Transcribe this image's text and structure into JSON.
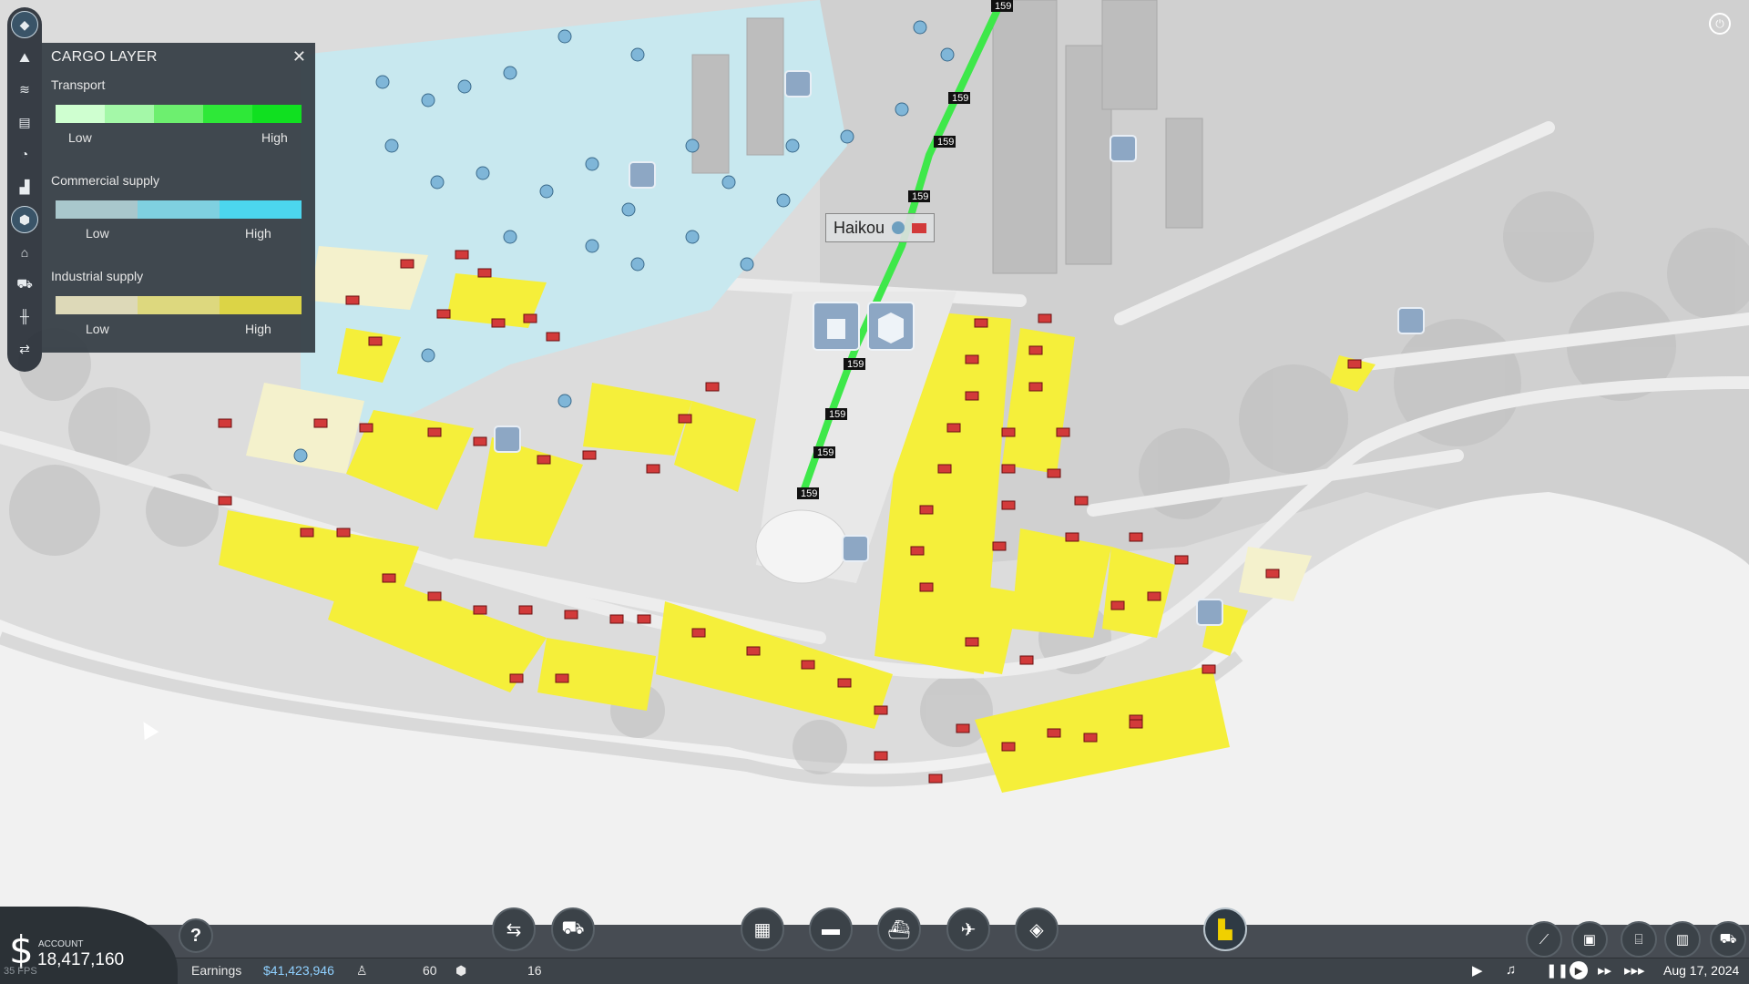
{
  "cargo_panel": {
    "title": "CARGO LAYER",
    "close_symbol": "✕",
    "legends": [
      {
        "name": "Transport",
        "low": "Low",
        "high": "High",
        "colors": [
          "#cfffd0",
          "#a4f8a8",
          "#6def6f",
          "#2ee838",
          "#10e020"
        ]
      },
      {
        "name": "Commercial supply",
        "low": "Low",
        "high": "High",
        "colors": [
          "#a9c7cc",
          "#7fd0e0",
          "#4cd6ee"
        ]
      },
      {
        "name": "Industrial supply",
        "low": "Low",
        "high": "High",
        "colors": [
          "#ddd9b8",
          "#ddd87e",
          "#dcd446"
        ]
      }
    ]
  },
  "map": {
    "city_name": "Haikou",
    "line_label": "159",
    "colors": {
      "residential_commercial": "#c8e9f0",
      "industrial": "#f5ef3a",
      "industrial_pale": "#f4f1cc",
      "rail_line": "#3ee84a",
      "water": "#eeeeee",
      "ground": "#e0e0e0"
    }
  },
  "left_rail": {
    "icons": [
      "layers-icon",
      "map-view-icon",
      "traffic-waves-icon",
      "statistics-icon",
      "speed-icon",
      "industry-icon",
      "cargo-icon",
      "town-icon",
      "vehicles-icon",
      "audio-icon",
      "route-icon"
    ]
  },
  "bottom_bar": {
    "account_label": "ACCOUNT",
    "account_value": "18,417,160",
    "currency_symbol": "$",
    "fps": "35 FPS",
    "earnings_label": "Earnings",
    "earnings_value": "$41,423,946",
    "passengers_value": "60",
    "cargo_value": "16",
    "date": "Aug 17, 2024",
    "help_symbol": "?",
    "tool_icons": [
      "lines-manager-icon",
      "vehicle-manager-icon",
      "road-vehicle-icon",
      "train-icon",
      "ship-icon",
      "airplane-icon",
      "terrain-icon",
      "bulldozer-icon"
    ],
    "right_icons": [
      "track-icon",
      "depot-icon",
      "station-icon",
      "town-building-icon",
      "vehicle-depot-icon"
    ]
  }
}
